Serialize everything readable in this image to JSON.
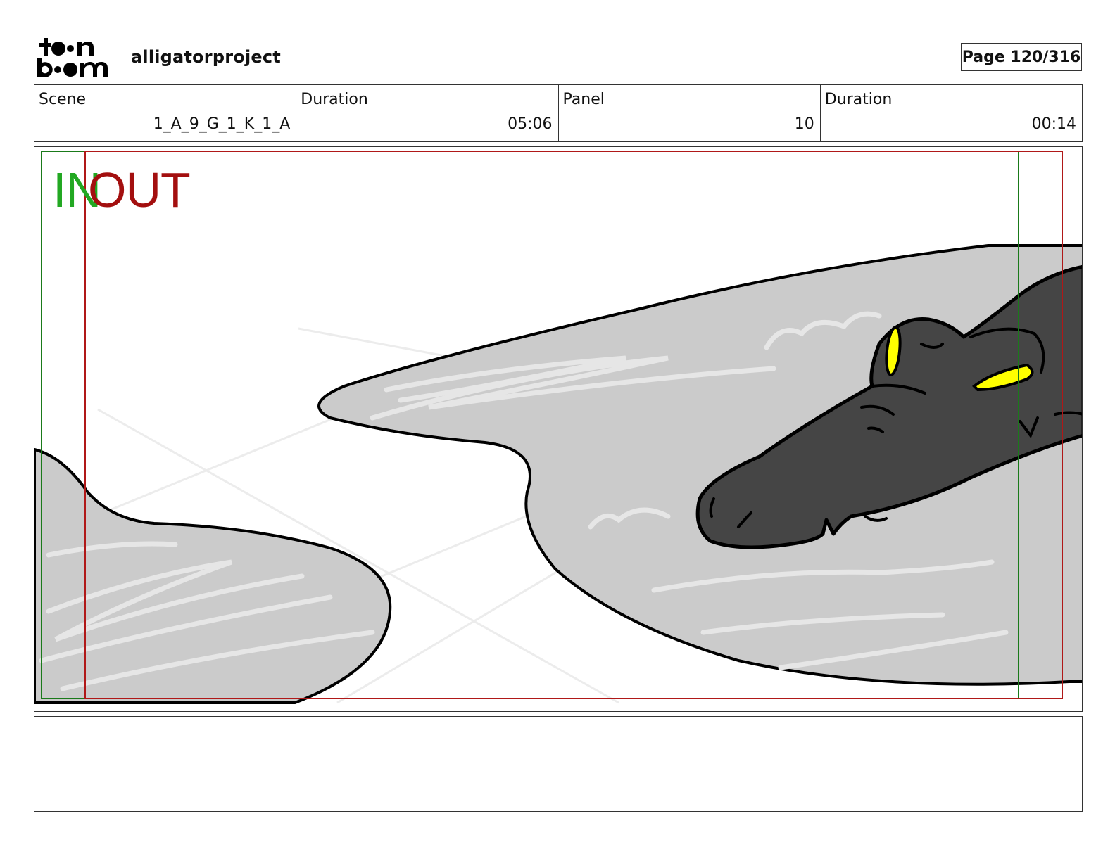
{
  "header": {
    "logo_text": "toon boom",
    "project_name": "alligatorproject",
    "page_label": "Page 120/316"
  },
  "info": [
    {
      "label": "Scene",
      "value": "1_A_9_G_1_K_1_A"
    },
    {
      "label": "Duration",
      "value": "05:06"
    },
    {
      "label": "Panel",
      "value": "10"
    },
    {
      "label": "Duration",
      "value": "00:14"
    }
  ],
  "panel": {
    "in_label": "IN",
    "out_label": "OUT",
    "colors": {
      "water": "#cbcbcb",
      "alligator": "#454545",
      "eyes": "#ffff00",
      "in_marker": "#1a7a1a",
      "out_marker": "#b01818"
    },
    "illustration": "alligator-drawing"
  },
  "notes": {
    "text": ""
  }
}
